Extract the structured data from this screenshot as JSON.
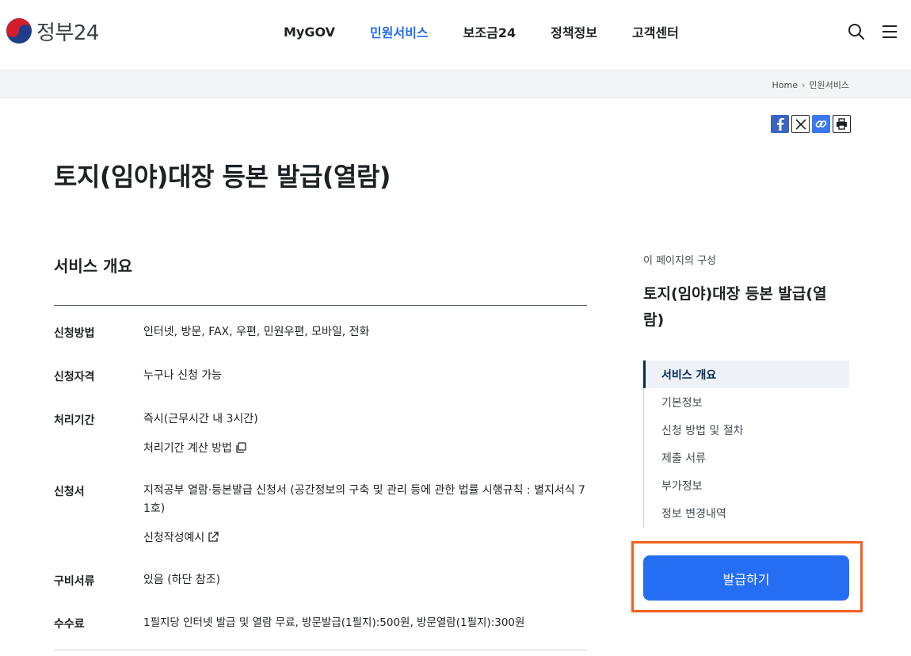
{
  "header": {
    "logo_text": "정부24",
    "nav": [
      "MyGOV",
      "민원서비스",
      "보조금24",
      "정책정보",
      "고객센터"
    ],
    "active_nav": "민원서비스"
  },
  "breadcrumb": {
    "home": "Home",
    "current": "민원서비스"
  },
  "page": {
    "title": "토지(임야)대장 등본 발급(열람)",
    "section_title": "서비스 개요"
  },
  "overview": {
    "method": {
      "label": "신청방법",
      "value": "인터넷, 방문, FAX, 우편, 민원우편, 모바일, 전화"
    },
    "eligibility": {
      "label": "신청자격",
      "value": "누구나 신청 가능"
    },
    "duration": {
      "label": "처리기간",
      "value": "즉시(근무시간 내 3시간)",
      "link": "처리기간 계산 방법"
    },
    "form": {
      "label": "신청서",
      "value_line1": "지적공부 열람·등본발급 신청서 (공간정보의 구축 및 관리 등에 관한 법률 시행규칙 : 별지서식 7",
      "value_line2": "1호)",
      "link": "신청작성예시"
    },
    "documents": {
      "label": "구비서류",
      "value": "있음 (하단 참조)"
    },
    "fee": {
      "label": "수수료",
      "value": "1필지당 인터넷 발급 및 열람 무료, 방문발급(1필지):500원, 방문열람(1필지):300원"
    }
  },
  "side": {
    "caption": "이 페이지의 구성",
    "title": "토지(임야)대장 등본 발급(열람)",
    "toc": [
      "서비스 개요",
      "기본정보",
      "신청 방법 및 절차",
      "제출 서류",
      "부가정보",
      "정보 변경내역"
    ],
    "issue_button": "발급하기"
  },
  "colors": {
    "accent": "#256ef4",
    "highlight": "#f5601e",
    "toc_active": "#052b57"
  }
}
